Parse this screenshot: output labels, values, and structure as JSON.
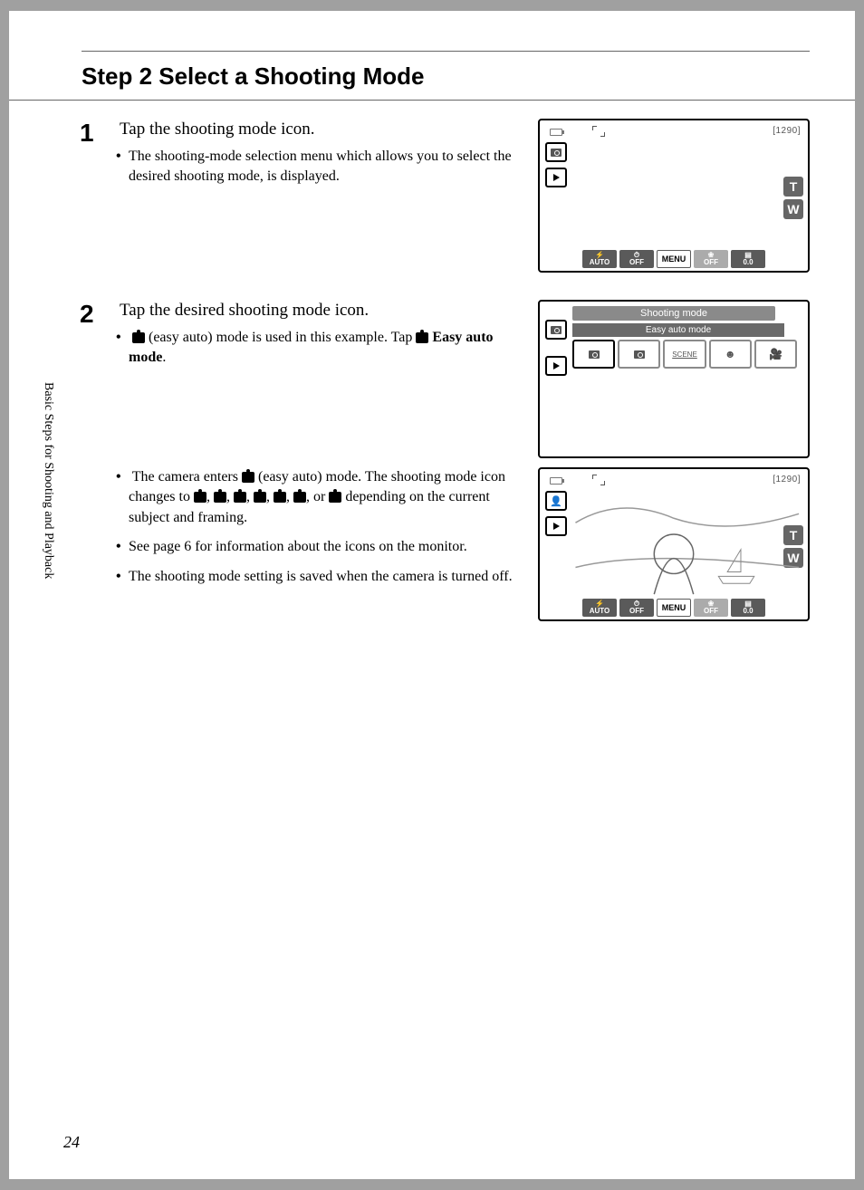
{
  "page_number": "24",
  "side_tab": "Basic Steps for Shooting and Playback",
  "title": "Step 2 Select a Shooting Mode",
  "step1": {
    "num": "1",
    "heading": "Tap the shooting mode icon.",
    "bullet1": "The shooting-mode selection menu which allows you to select the desired shooting mode, is displayed."
  },
  "step2": {
    "num": "2",
    "heading": "Tap the desired shooting mode icon.",
    "bullet1a": " (easy auto) mode is used in this example. Tap ",
    "bullet1b": " Easy auto mode",
    "bullet1c": ".",
    "bullet2a": "The camera enters ",
    "bullet2b": " (easy auto) mode. The shooting mode icon changes to ",
    "bullet2c": " depending on the current subject and framing.",
    "bullet3": "See page 6 for information about the icons on the monitor.",
    "bullet4": "The shooting mode setting is saved when the camera is turned off."
  },
  "screen1": {
    "counter": "[1290]",
    "bottom": {
      "flash": "AUTO",
      "timer": "OFF",
      "menu": "MENU",
      "macro": "OFF",
      "ev": "0.0"
    },
    "zoom_in": "T",
    "zoom_out": "W"
  },
  "screen2": {
    "header": "Shooting mode",
    "sub": "Easy auto mode",
    "modes": {
      "scene": "SCENE"
    }
  },
  "screen3": {
    "counter": "[1290]",
    "bottom": {
      "flash": "AUTO",
      "timer": "OFF",
      "menu": "MENU",
      "macro": "OFF",
      "ev": "0.0"
    },
    "zoom_in": "T",
    "zoom_out": "W"
  }
}
